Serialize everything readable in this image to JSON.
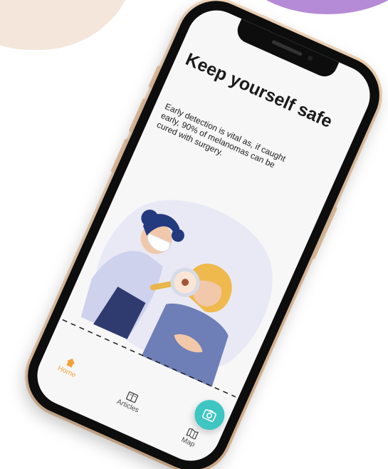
{
  "screen": {
    "title": "Keep yourself safe",
    "description": "Early detection is vital as, if caught early, 90% of melanomas can be cured with surgery."
  },
  "nav": {
    "items": [
      {
        "label": "Home",
        "icon": "home-icon",
        "active": true
      },
      {
        "label": "Articles",
        "icon": "articles-icon",
        "active": false
      },
      {
        "label": "Map",
        "icon": "map-icon",
        "active": false
      }
    ],
    "fab_icon": "camera-icon"
  },
  "colors": {
    "accent": "#f2a33a",
    "fab": "#3ec6c3",
    "blob_beige": "#f4e6da",
    "blob_purple": "#b58ad6",
    "phone_frame": "#e7c09a"
  }
}
